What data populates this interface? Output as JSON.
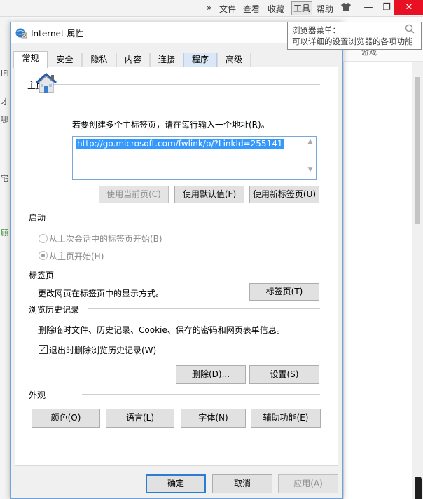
{
  "browser": {
    "menu": [
      "»",
      "文件",
      "查看",
      "收藏",
      "工具",
      "帮助"
    ],
    "win_min": "—",
    "win_restore": "❐",
    "win_close": "✕",
    "tooltip_title": "浏览器菜单：",
    "tooltip_body": "可以详细的设置浏览器的各项功能",
    "games": "游戏",
    "left_fragments": [
      "iFi",
      "才",
      "哪",
      "宅",
      "顾"
    ]
  },
  "dialog": {
    "title": "Internet 属性",
    "tabs": [
      "常规",
      "安全",
      "隐私",
      "内容",
      "连接",
      "程序",
      "高级"
    ],
    "home": {
      "label": "主页",
      "instruction": "若要创建多个主标签页，请在每行输入一个地址(R)。",
      "url": "http://go.microsoft.com/fwlink/p/?LinkId=255141",
      "btn_current": "使用当前页(C)",
      "btn_default": "使用默认值(F)",
      "btn_newtab": "使用新标签页(U)"
    },
    "startup": {
      "label": "启动",
      "option1": "从上次会话中的标签页开始(B)",
      "option2": "从主页开始(H)"
    },
    "tabs_section": {
      "label": "标签页",
      "desc": "更改网页在标签页中的显示方式。",
      "btn": "标签页(T)"
    },
    "history": {
      "label": "浏览历史记录",
      "desc": "删除临时文件、历史记录、Cookie、保存的密码和网页表单信息。",
      "checkbox_label": "退出时删除浏览历史记录(W)",
      "checkbox_checked": true,
      "btn_delete": "删除(D)...",
      "btn_settings": "设置(S)"
    },
    "appearance": {
      "label": "外观",
      "btn_colors": "颜色(O)",
      "btn_languages": "语言(L)",
      "btn_fonts": "字体(N)",
      "btn_accessibility": "辅助功能(E)"
    },
    "footer": {
      "ok": "确定",
      "cancel": "取消",
      "apply": "应用(A)"
    }
  }
}
